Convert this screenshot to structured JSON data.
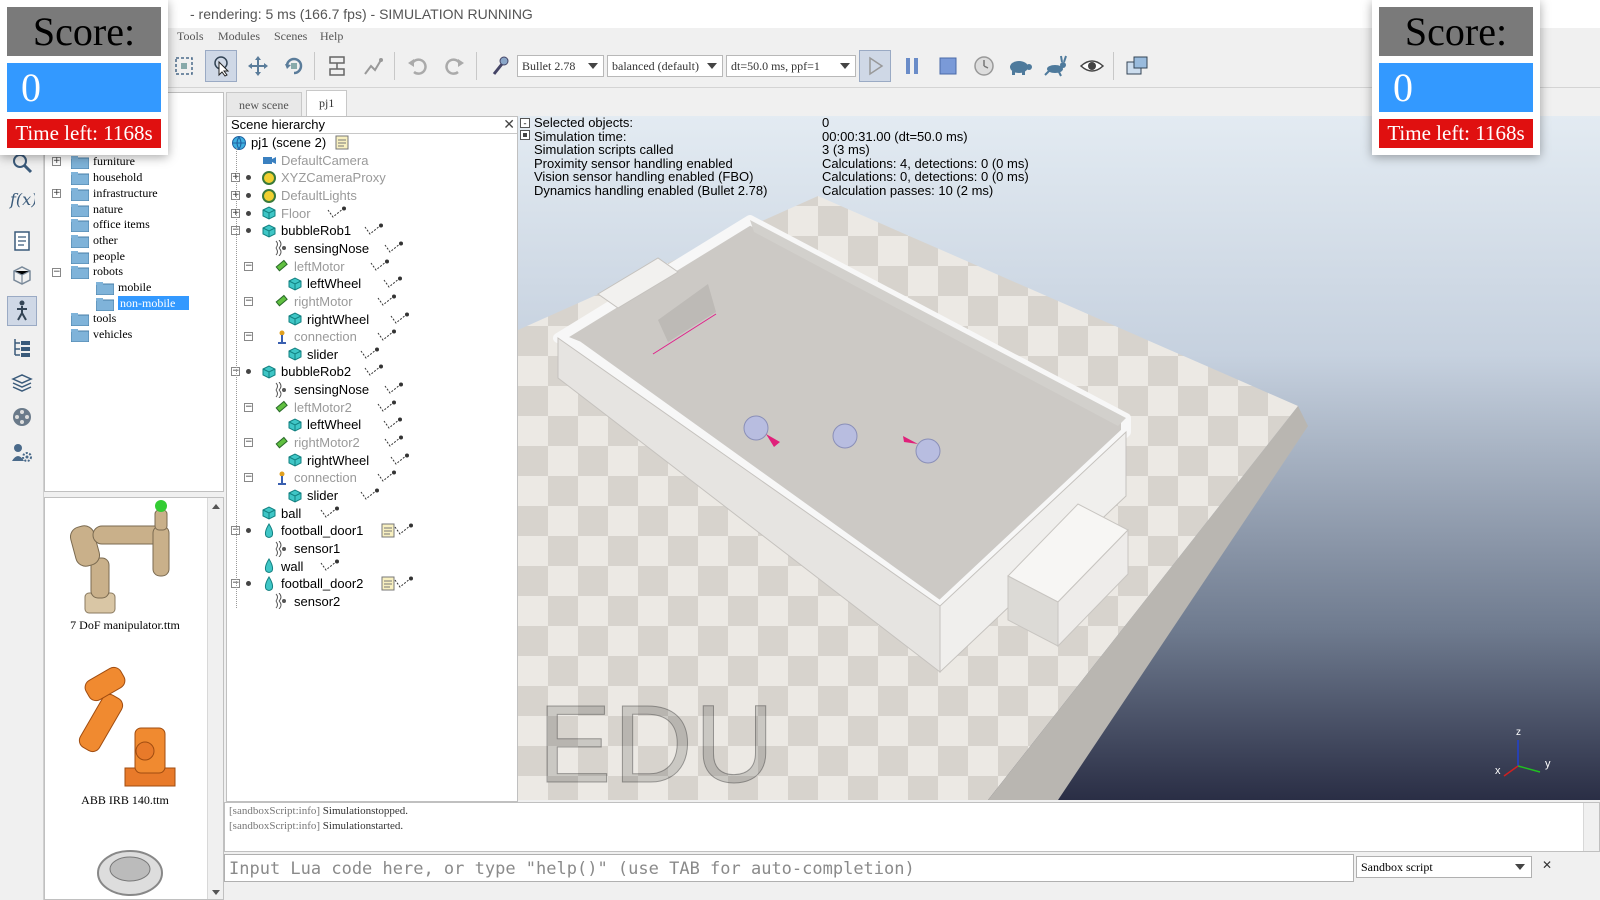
{
  "window": {
    "title": "- rendering: 5 ms (166.7 fps) - SIMULATION RUNNING"
  },
  "menu": [
    "Tools",
    "Modules",
    "Scenes",
    "Help"
  ],
  "toolbar": {
    "engine": "Bullet 2.78",
    "mode": "balanced (default)",
    "timestep": "dt=50.0 ms, ppf=1"
  },
  "model_browser": {
    "folders": [
      {
        "label": "furniture",
        "expandable": true
      },
      {
        "label": "household",
        "expandable": false
      },
      {
        "label": "infrastructure",
        "expandable": true
      },
      {
        "label": "nature",
        "expandable": false
      },
      {
        "label": "office items",
        "expandable": false
      },
      {
        "label": "other",
        "expandable": false
      },
      {
        "label": "people",
        "expandable": false
      },
      {
        "label": "robots",
        "expandable": true
      },
      {
        "label": "mobile",
        "expandable": false
      },
      {
        "label": "non-mobile",
        "expandable": false
      },
      {
        "label": "tools",
        "expandable": false
      },
      {
        "label": "vehicles",
        "expandable": false
      }
    ],
    "thumbnails": [
      "7 DoF manipulator.ttm",
      "ABB IRB 140.ttm"
    ]
  },
  "scene_tabs": [
    "new scene",
    "pj1"
  ],
  "hierarchy": {
    "header": "Scene hierarchy",
    "root": "pj1 (scene 2)",
    "items": [
      "DefaultCamera",
      "XYZCameraProxy",
      "DefaultLights",
      "Floor",
      "bubbleRob1",
      "sensingNose",
      "leftMotor",
      "leftWheel",
      "rightMotor",
      "rightWheel",
      "connection",
      "slider",
      "bubbleRob2",
      "sensingNose",
      "leftMotor2",
      "leftWheel",
      "rightMotor2",
      "rightWheel",
      "connection",
      "slider",
      "ball",
      "football_door1",
      "sensor1",
      "wall",
      "football_door2",
      "sensor2"
    ]
  },
  "viewport": {
    "info": [
      {
        "label": "Selected objects:",
        "value": "0"
      },
      {
        "label": "Simulation time:",
        "value": "00:00:31.00 (dt=50.0 ms)"
      },
      {
        "label": "Simulation scripts called",
        "value": "3 (3 ms)"
      },
      {
        "label": "Proximity sensor handling enabled",
        "value": "Calculations: 4, detections: 0 (0 ms)"
      },
      {
        "label": "Vision sensor handling enabled (FBO)",
        "value": "Calculations: 0, detections: 0 (0 ms)"
      },
      {
        "label": "Dynamics handling enabled (Bullet 2.78)",
        "value": "Calculation passes: 10 (2 ms)"
      }
    ],
    "watermark": "EDU",
    "axes": {
      "x": "x",
      "y": "y",
      "z": "z"
    }
  },
  "console": {
    "lines": [
      {
        "tag": "[sandboxScript:info]",
        "text": "Simulationstopped."
      },
      {
        "tag": "[sandboxScript:info]",
        "text": "Simulationstarted."
      }
    ],
    "input_placeholder": "Input Lua code here, or type \"help()\" (use TAB for auto-completion)",
    "script_selector": "Sandbox script"
  },
  "score_left": {
    "title": "Score:",
    "value": "0",
    "time": "Time left: 1168s"
  },
  "score_right": {
    "title": "Score:",
    "value": "0",
    "time": "Time left: 1168s"
  },
  "colors": {
    "score_blue": "#3399ff",
    "score_red": "#e01010",
    "score_gray": "#7a7a7a",
    "selection": "#3399ff"
  }
}
